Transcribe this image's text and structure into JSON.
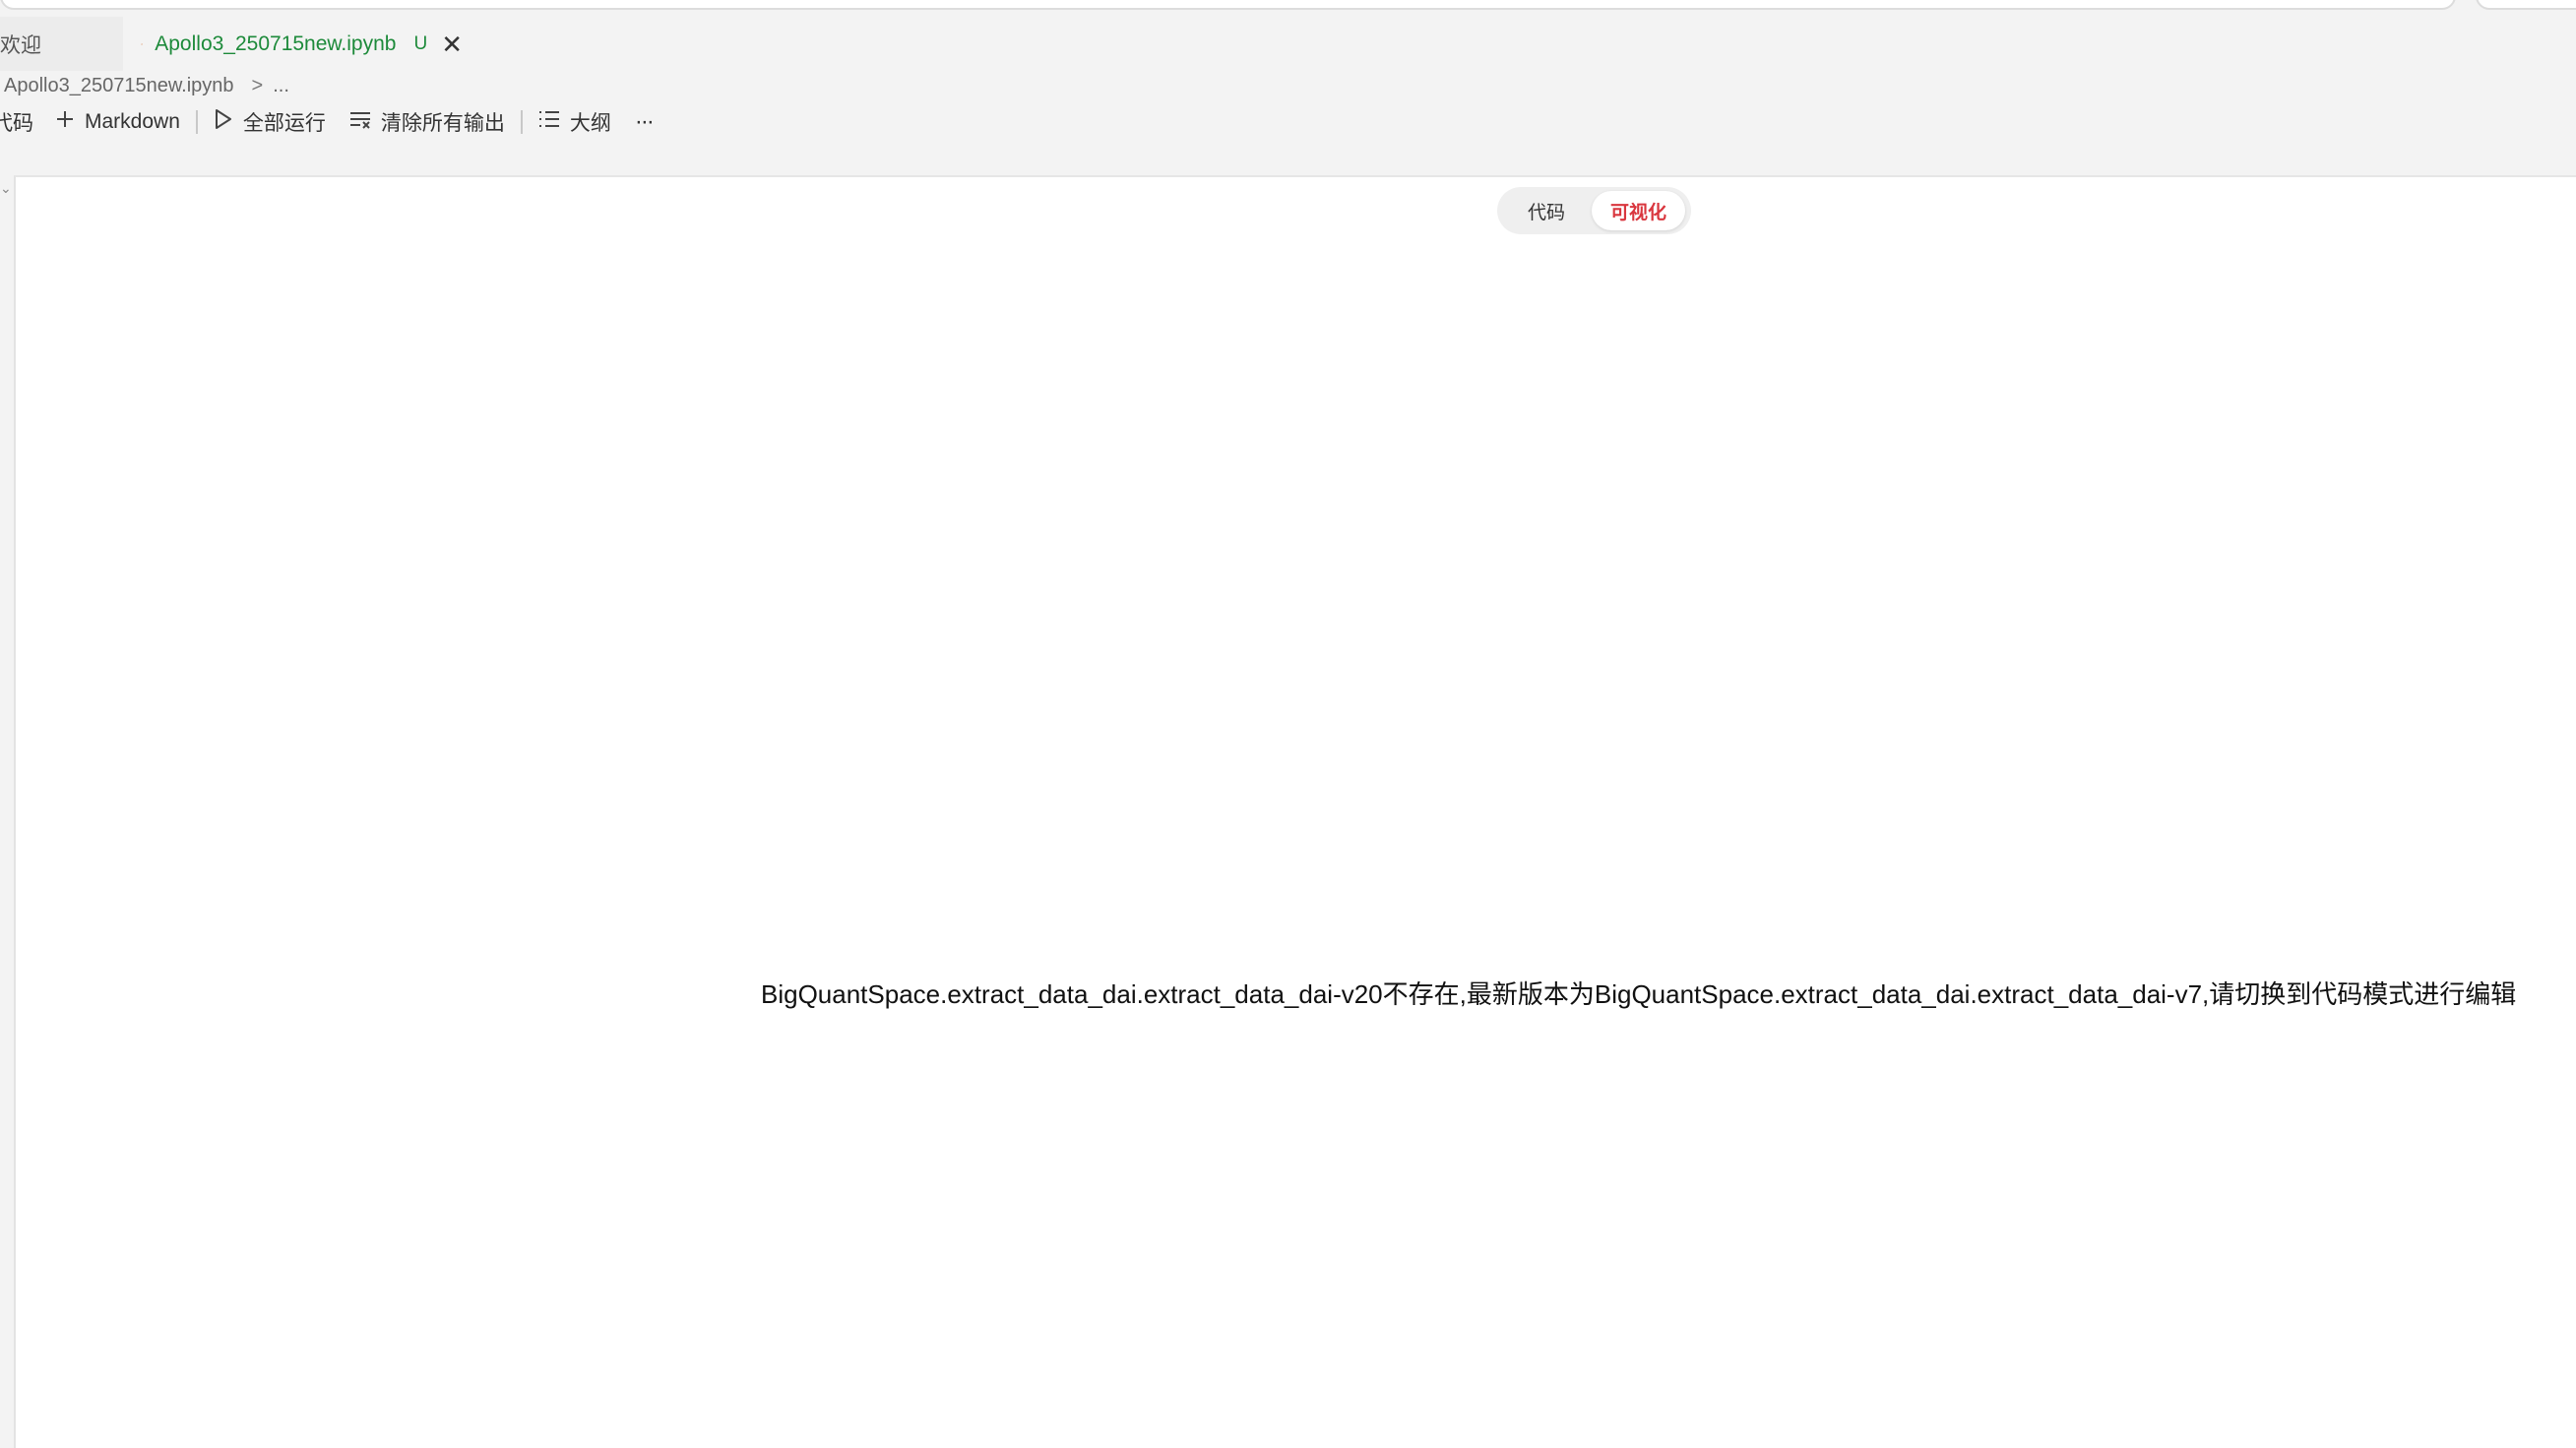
{
  "tabs": {
    "welcome_label": "欢迎",
    "active_label": "Apollo3_250715new.ipynb",
    "active_status": "U",
    "close_glyph": "✕"
  },
  "breadcrumb": {
    "file": "Apollo3_250715new.ipynb",
    "separator": ">",
    "more": "..."
  },
  "toolbar": {
    "code_label": "代码",
    "markdown_label": "Markdown",
    "run_all_label": "全部运行",
    "clear_outputs_label": "清除所有输出",
    "outline_label": "大纲",
    "more_glyph": "···"
  },
  "mode_toggle": {
    "code_label": "代码",
    "visual_label": "可视化",
    "selected": "可视化"
  },
  "main": {
    "message": "BigQuantSpace.extract_data_dai.extract_data_dai-v20不存在,最新版本为BigQuantSpace.extract_data_dai.extract_data_dai-v7,请切换到代码模式进行编辑"
  },
  "colors": {
    "accent_red": "#d9363e",
    "tab_green": "#1d8a3a",
    "file_icon_orange": "#e37933"
  }
}
